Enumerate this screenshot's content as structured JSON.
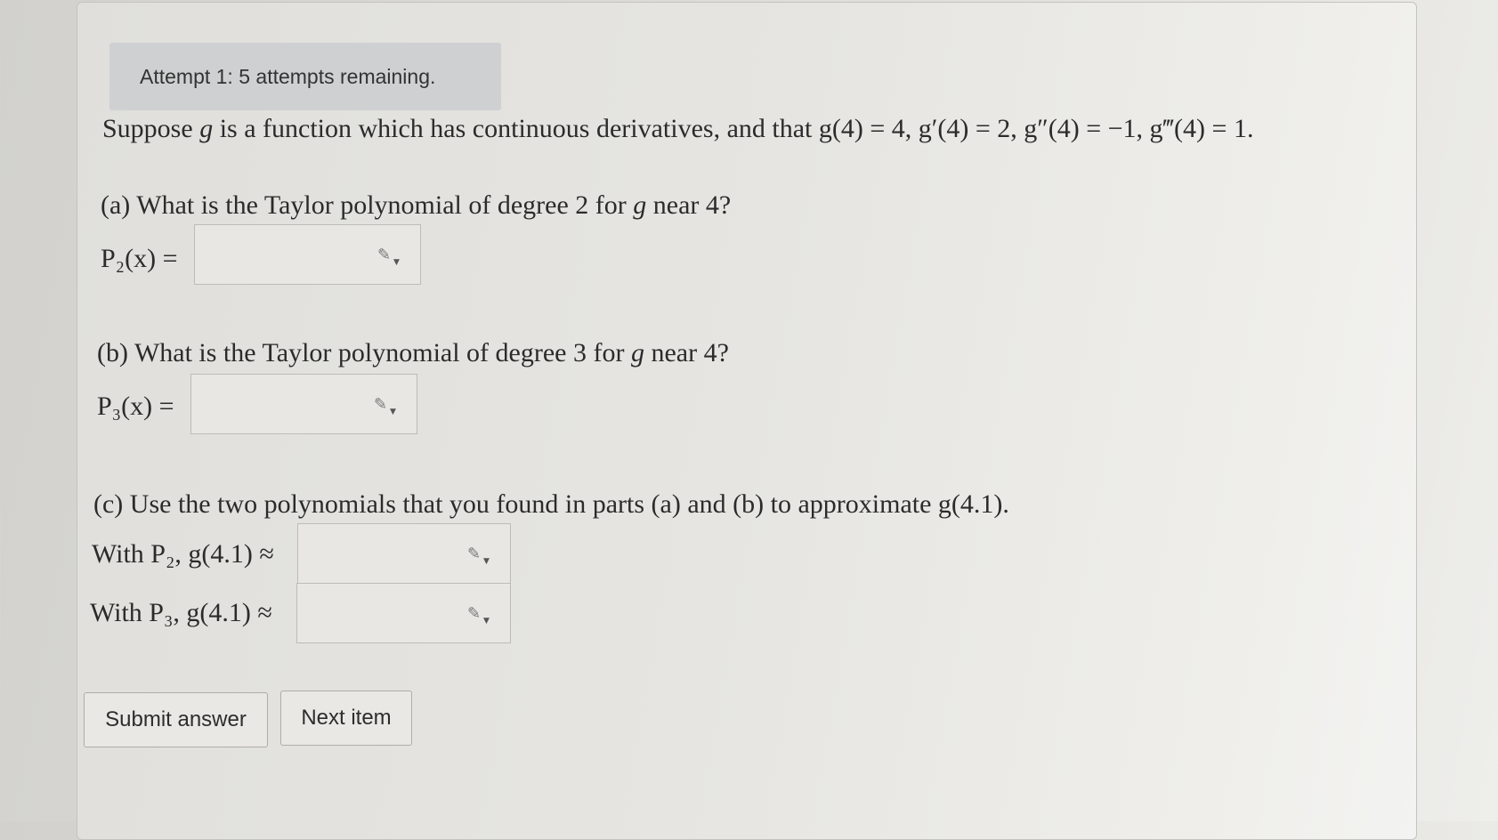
{
  "attempt_banner": "Attempt 1: 5 attempts remaining.",
  "problem": {
    "intro_prefix": "Suppose ",
    "intro_var": "g",
    "intro_mid": " is a function which has continuous derivatives, and that ",
    "intro_conditions": "g(4) = 4, g′(4) = 2, g″(4) = −1, g‴(4) = 1."
  },
  "part_a": {
    "question_prefix": "(a) What is the Taylor polynomial of degree 2 for ",
    "question_var": "g",
    "question_suffix": " near 4?",
    "label": "P₂(x) =",
    "value": ""
  },
  "part_b": {
    "question_prefix": "(b) What is the Taylor polynomial of degree 3 for ",
    "question_var": "g",
    "question_suffix": " near 4?",
    "label": "P₃(x) =",
    "value": ""
  },
  "part_c": {
    "question": "(c) Use the two polynomials that you found in parts (a) and (b) to approximate g(4.1).",
    "p2_label": "With P₂, g(4.1) ≈",
    "p2_value": "",
    "p3_label": "With P₃, g(4.1) ≈",
    "p3_value": ""
  },
  "icons": {
    "answer_tool": "pencil-dropdown-icon"
  },
  "buttons": {
    "submit": "Submit answer",
    "next": "Next item"
  }
}
